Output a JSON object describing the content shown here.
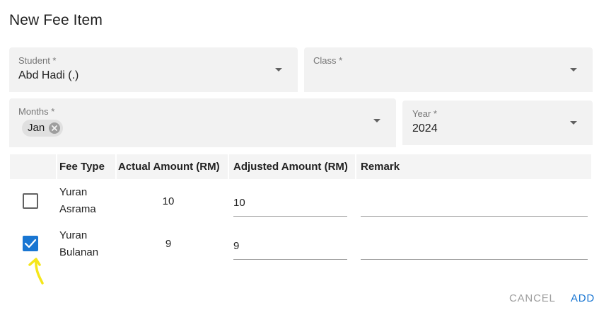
{
  "dialog": {
    "title": "New Fee Item"
  },
  "form": {
    "student": {
      "label": "Student *",
      "value": "Abd Hadi (.)"
    },
    "class": {
      "label": "Class *",
      "value": ""
    },
    "months": {
      "label": "Months *",
      "chips": [
        "Jan"
      ]
    },
    "year": {
      "label": "Year *",
      "value": "2024"
    }
  },
  "table": {
    "headers": [
      "",
      "Fee Type",
      "Actual Amount (RM)",
      "Adjusted Amount (RM)",
      "Remark"
    ],
    "rows": [
      {
        "checked": false,
        "fee_type_line1": "Yuran",
        "fee_type_line2": "Asrama",
        "actual": "10",
        "adjusted": "10",
        "remark": ""
      },
      {
        "checked": true,
        "fee_type_line1": "Yuran",
        "fee_type_line2": "Bulanan",
        "actual": "9",
        "adjusted": "9",
        "remark": ""
      }
    ]
  },
  "actions": {
    "cancel_label": "CANCEL",
    "add_label": "ADD"
  },
  "colors": {
    "primary": "#1976d2",
    "disabled_text": "#9e9e9e",
    "annotation": "#f5e61a"
  }
}
